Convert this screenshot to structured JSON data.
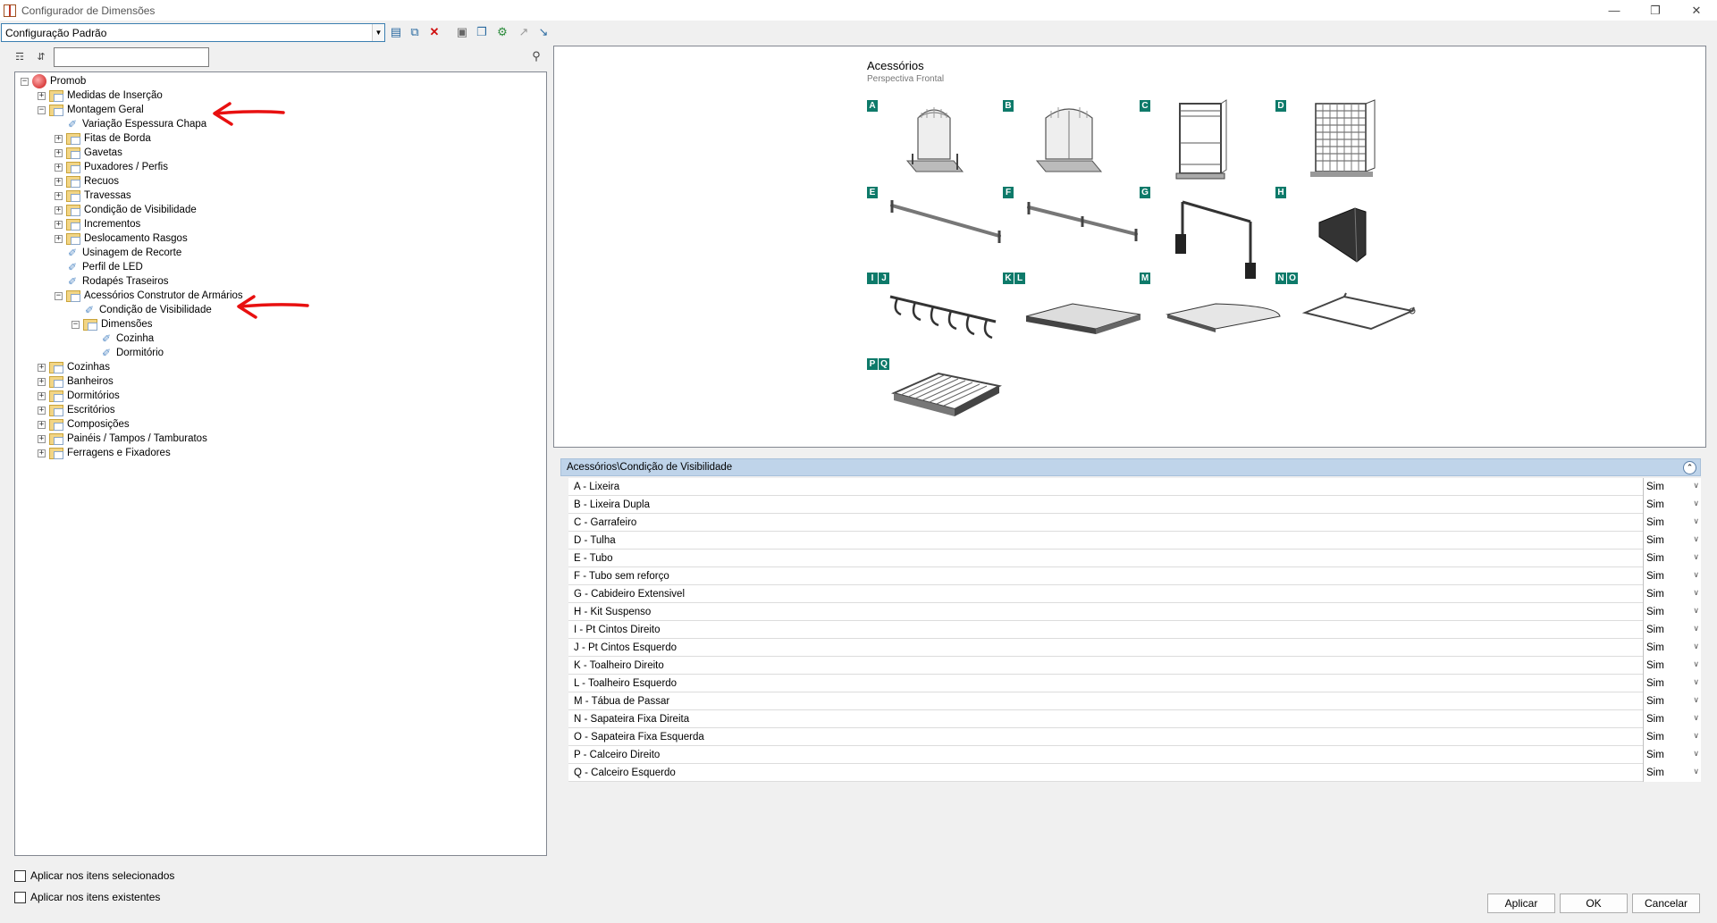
{
  "window": {
    "title": "Configurador de Dimensões"
  },
  "toolbar": {
    "config_value": "Configuração Padrão"
  },
  "tree": {
    "items": [
      {
        "label": "Promob",
        "level": 0,
        "kind": "root",
        "exp": "−"
      },
      {
        "label": "Medidas de Inserção",
        "level": 1,
        "kind": "folder",
        "exp": "+"
      },
      {
        "label": "Montagem Geral",
        "level": 1,
        "kind": "folder",
        "exp": "−"
      },
      {
        "label": "Variação Espessura Chapa",
        "level": 2,
        "kind": "leaf",
        "exp": ""
      },
      {
        "label": "Fitas de Borda",
        "level": 2,
        "kind": "folder",
        "exp": "+"
      },
      {
        "label": "Gavetas",
        "level": 2,
        "kind": "folder",
        "exp": "+"
      },
      {
        "label": "Puxadores / Perfis",
        "level": 2,
        "kind": "folder",
        "exp": "+"
      },
      {
        "label": "Recuos",
        "level": 2,
        "kind": "folder",
        "exp": "+"
      },
      {
        "label": "Travessas",
        "level": 2,
        "kind": "folder",
        "exp": "+"
      },
      {
        "label": "Condição de Visibilidade",
        "level": 2,
        "kind": "folder",
        "exp": "+"
      },
      {
        "label": "Incrementos",
        "level": 2,
        "kind": "folder",
        "exp": "+"
      },
      {
        "label": "Deslocamento Rasgos",
        "level": 2,
        "kind": "folder",
        "exp": "+"
      },
      {
        "label": "Usinagem de Recorte",
        "level": 2,
        "kind": "leaf",
        "exp": ""
      },
      {
        "label": "Perfil de LED",
        "level": 2,
        "kind": "leaf",
        "exp": ""
      },
      {
        "label": "Rodapés Traseiros",
        "level": 2,
        "kind": "leaf",
        "exp": ""
      },
      {
        "label": "Acessórios Construtor de Armários",
        "level": 2,
        "kind": "folder",
        "exp": "−"
      },
      {
        "label": "Condição de Visibilidade",
        "level": 3,
        "kind": "leaf",
        "exp": ""
      },
      {
        "label": "Dimensões",
        "level": 3,
        "kind": "folder",
        "exp": "−"
      },
      {
        "label": "Cozinha",
        "level": 4,
        "kind": "leaf",
        "exp": ""
      },
      {
        "label": "Dormitório",
        "level": 4,
        "kind": "leaf",
        "exp": ""
      },
      {
        "label": "Cozinhas",
        "level": 1,
        "kind": "folder",
        "exp": "+"
      },
      {
        "label": "Banheiros",
        "level": 1,
        "kind": "folder",
        "exp": "+"
      },
      {
        "label": "Dormitórios",
        "level": 1,
        "kind": "folder",
        "exp": "+"
      },
      {
        "label": "Escritórios",
        "level": 1,
        "kind": "folder",
        "exp": "+"
      },
      {
        "label": "Composições",
        "level": 1,
        "kind": "folder",
        "exp": "+"
      },
      {
        "label": "Painéis / Tampos / Tamburatos",
        "level": 1,
        "kind": "folder",
        "exp": "+"
      },
      {
        "label": "Ferragens e Fixadores",
        "level": 1,
        "kind": "folder",
        "exp": "+"
      }
    ]
  },
  "options": {
    "apply_selected": "Aplicar nos itens selecionados",
    "apply_existing": "Aplicar nos itens existentes"
  },
  "preview": {
    "title": "Acessórios",
    "subtitle": "Perspectiva Frontal",
    "letters": [
      {
        "text": [
          "A"
        ]
      },
      {
        "text": [
          "B"
        ]
      },
      {
        "text": [
          "C"
        ]
      },
      {
        "text": [
          "D"
        ]
      },
      {
        "text": [
          "E"
        ]
      },
      {
        "text": [
          "F"
        ]
      },
      {
        "text": [
          "G"
        ]
      },
      {
        "text": [
          "H"
        ]
      },
      {
        "text": [
          "I",
          "J"
        ]
      },
      {
        "text": [
          "K",
          "L"
        ]
      },
      {
        "text": [
          "M"
        ]
      },
      {
        "text": [
          "N",
          "O"
        ]
      },
      {
        "text": [
          "P",
          "Q"
        ]
      }
    ]
  },
  "properties": {
    "header": "Acessórios\\Condição de Visibilidade",
    "rows": [
      {
        "label": "A -  Lixeira",
        "value": "Sim"
      },
      {
        "label": "B -  Lixeira Dupla",
        "value": "Sim"
      },
      {
        "label": "C -  Garrafeiro",
        "value": "Sim"
      },
      {
        "label": "D -  Tulha",
        "value": "Sim"
      },
      {
        "label": "E -  Tubo",
        "value": "Sim"
      },
      {
        "label": "F -  Tubo sem reforço",
        "value": "Sim"
      },
      {
        "label": "G -  Cabideiro Extensivel",
        "value": "Sim"
      },
      {
        "label": "H -  Kit Suspenso",
        "value": "Sim"
      },
      {
        "label": "I -  Pt Cintos Direito",
        "value": "Sim"
      },
      {
        "label": "J -  Pt Cintos Esquerdo",
        "value": "Sim"
      },
      {
        "label": "K -  Toalheiro Direito",
        "value": "Sim"
      },
      {
        "label": "L -  Toalheiro Esquerdo",
        "value": "Sim"
      },
      {
        "label": "M -  Tábua de Passar",
        "value": "Sim"
      },
      {
        "label": "N -  Sapateira Fixa Direita",
        "value": "Sim"
      },
      {
        "label": "O -  Sapateira Fixa Esquerda",
        "value": "Sim"
      },
      {
        "label": "P -  Calceiro Direito",
        "value": "Sim"
      },
      {
        "label": "Q -  Calceiro Esquerdo",
        "value": "Sim"
      }
    ]
  },
  "buttons": {
    "apply": "Aplicar",
    "ok": "OK",
    "cancel": "Cancelar"
  }
}
